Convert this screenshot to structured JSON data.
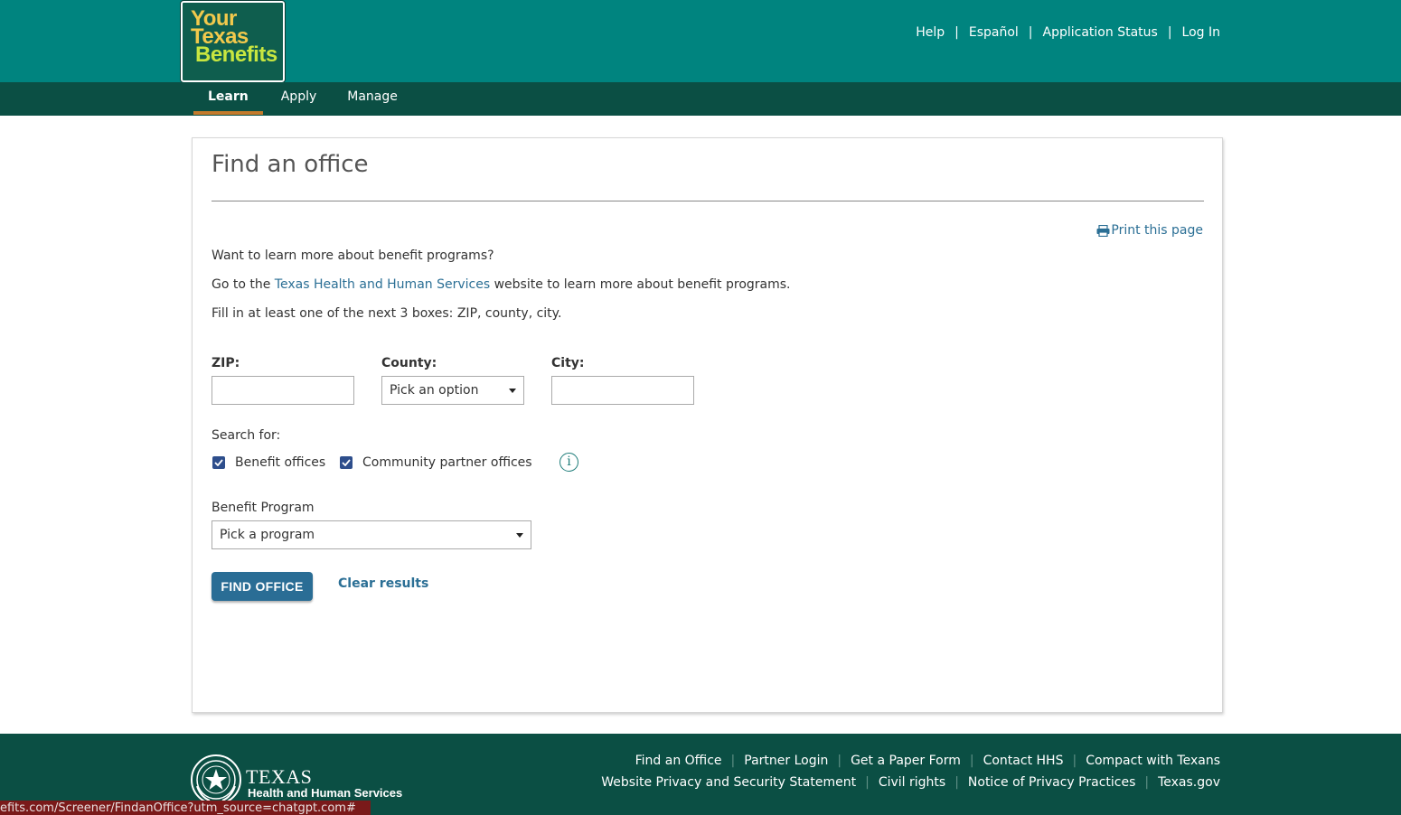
{
  "header": {
    "logo": {
      "line1": "Your",
      "line2": "Texas",
      "line3": "Benefits"
    },
    "utility_links": [
      "Help",
      "Español",
      "Application Status",
      "Log In"
    ],
    "nav": [
      {
        "label": "Learn",
        "active": true
      },
      {
        "label": "Apply",
        "active": false
      },
      {
        "label": "Manage",
        "active": false
      }
    ]
  },
  "main": {
    "title": "Find an office",
    "print_link": "Print this page",
    "intro_question": "Want to learn more about benefit programs?",
    "goto_prefix": "Go to the ",
    "goto_link": "Texas Health and Human Services",
    "goto_suffix": " website to learn more about benefit programs.",
    "instructions": "Fill in at least one of the next 3 boxes: ZIP, county, city.",
    "zip": {
      "label": "ZIP:",
      "value": ""
    },
    "county": {
      "label": "County:",
      "selected": "Pick an option"
    },
    "city": {
      "label": "City:",
      "value": ""
    },
    "search_for": {
      "label": "Search for:",
      "options": [
        {
          "label": "Benefit offices",
          "checked": true
        },
        {
          "label": "Community partner offices",
          "checked": true
        }
      ]
    },
    "benefit_program": {
      "label": "Benefit Program",
      "selected": "Pick a program"
    },
    "find_button": "FIND OFFICE",
    "clear_link": "Clear results"
  },
  "footer": {
    "org_name": "TEXAS",
    "org_sub": "Health and Human Services",
    "row1": [
      "Find an Office",
      "Partner Login",
      "Get a Paper Form",
      "Contact HHS",
      "Compact with Texans"
    ],
    "row2": [
      "Website Privacy and Security Statement",
      "Civil rights",
      "Notice of Privacy Practices",
      "Texas.gov"
    ]
  },
  "status_bar_url": "efits.com/Screener/FindanOffice?utm_source=chatgpt.com#",
  "colors": {
    "header_teal": "#00847f",
    "nav_dark": "#0b4f44",
    "link_blue": "#2b6f95",
    "active_tab_underline": "#c47a2b",
    "button_blue": "#2a6d95"
  }
}
